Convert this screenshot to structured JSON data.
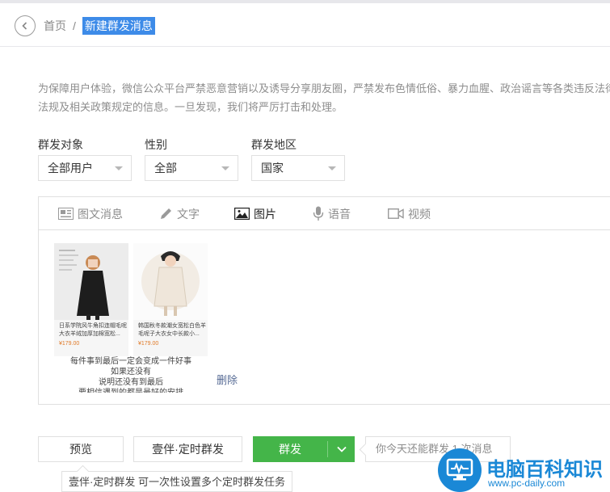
{
  "breadcrumb": {
    "home": "首页",
    "separator": "/",
    "current": "新建群发消息"
  },
  "notice": "为保障用户体验，微信公众平台严禁恶意营销以及诱导分享朋友圈，严禁发布色情低俗、暴力血腥、政治谣言等各类违反法律法规及相关政策规定的信息。一旦发现，我们将严厉打击和处理。",
  "filters": [
    {
      "label": "群发对象",
      "value": "全部用户"
    },
    {
      "label": "性别",
      "value": "全部"
    },
    {
      "label": "群发地区",
      "value": "国家"
    }
  ],
  "tabs": [
    {
      "label": "图文消息",
      "icon": "news-icon",
      "active": false
    },
    {
      "label": "文字",
      "icon": "pencil-icon",
      "active": false
    },
    {
      "label": "图片",
      "icon": "image-icon",
      "active": true
    },
    {
      "label": "语音",
      "icon": "microphone-icon",
      "active": false
    },
    {
      "label": "视频",
      "icon": "video-icon",
      "active": false
    }
  ],
  "image_card": {
    "products": [
      {
        "desc": "日系学院风牛角扣连帽毛呢大衣羊绒加厚加棉宽松...",
        "price": "¥179.00"
      },
      {
        "desc": "韩国秋冬款潮女宽松白色羊毛呢子大衣女中长款小...",
        "price": "¥179.00"
      }
    ],
    "caption": [
      "每件事到最后一定会变成一件好事",
      "如果还没有",
      "说明还没有到最后",
      "要相信遇到的都是最好的安排"
    ],
    "delete_label": "删除"
  },
  "actions": {
    "preview": "预览",
    "scheduled": "壹伴·定时群发",
    "send": "群发"
  },
  "quota_text": "你今天还能群发 1 次消息",
  "tooltip": "壹伴·定时群发 可一次性设置多个定时群发任务",
  "watermark": {
    "title": "电脑百科知识",
    "url": "www.pc-daily.com"
  },
  "colors": {
    "primary_green": "#44b549",
    "link_blue": "#576b95",
    "highlight_blue": "#3d8be8",
    "watermark_blue": "#1a88d6"
  }
}
